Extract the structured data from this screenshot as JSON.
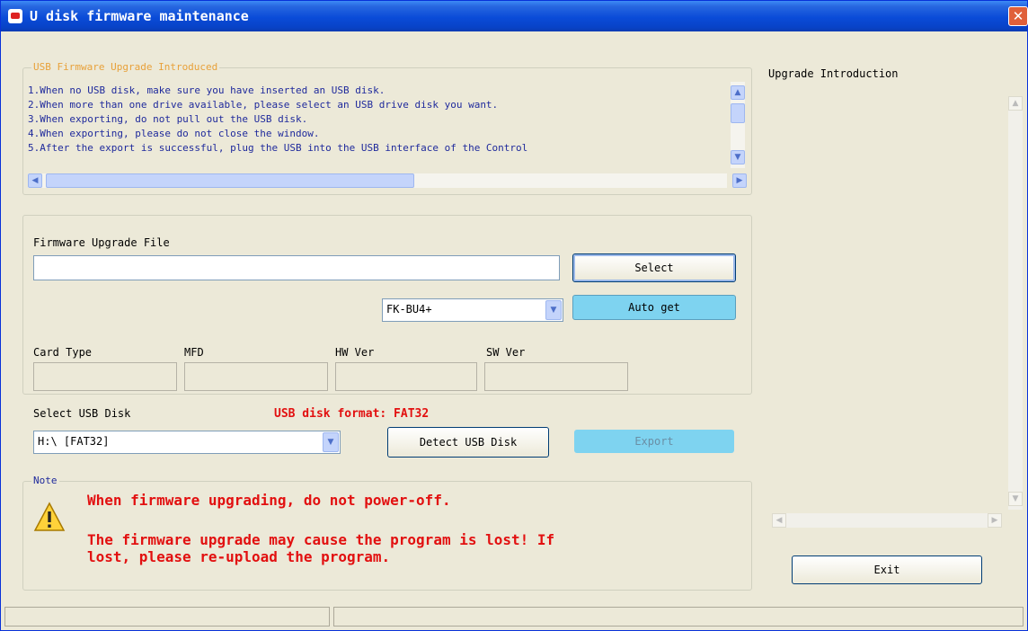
{
  "window": {
    "title": "U disk firmware maintenance",
    "close_glyph": "✕"
  },
  "intro_group": {
    "legend": "USB Firmware Upgrade Introduced",
    "lines": [
      "1.When no USB disk, make sure you have inserted an USB disk.",
      "2.When more than one drive available, please select an USB drive disk you want.",
      "3.When exporting, do not pull out the USB disk.",
      "4.When exporting, please do not close the window.",
      "5.After the export is successful, plug the USB into the USB interface of the Control"
    ]
  },
  "firmware": {
    "file_label": "Firmware Upgrade File",
    "file_value": "",
    "select_button": "Select",
    "model_value": "FK-BU4+",
    "auto_get_button": "Auto get"
  },
  "info": {
    "card_type_label": "Card Type",
    "mfd_label": "MFD",
    "hw_ver_label": "HW Ver",
    "sw_ver_label": "SW Ver",
    "card_type_value": "",
    "mfd_value": "",
    "hw_ver_value": "",
    "sw_ver_value": ""
  },
  "usb": {
    "select_label": "Select USB Disk",
    "format_note": "USB disk format: FAT32",
    "disk_value": "H:\\ [FAT32]",
    "detect_button": "Detect USB Disk",
    "export_button": "Export"
  },
  "note": {
    "legend": "Note",
    "line1": "When firmware upgrading, do not power-off.",
    "line2": "The firmware upgrade may cause the program is lost! If",
    "line3": "lost, please re-upload the program."
  },
  "right_panel": {
    "label": "Upgrade Introduction",
    "exit_button": "Exit"
  },
  "icons": {
    "scroll_up": "▲",
    "scroll_down": "▼",
    "scroll_left": "◀",
    "scroll_right": "▶",
    "combo_arrow": "▼",
    "warning": "warning-icon"
  },
  "colors": {
    "title_bar": "#0a4bd8",
    "warning_text": "#e21010",
    "intro_text": "#1f2a9c",
    "accent_button": "#7ed3f0"
  }
}
